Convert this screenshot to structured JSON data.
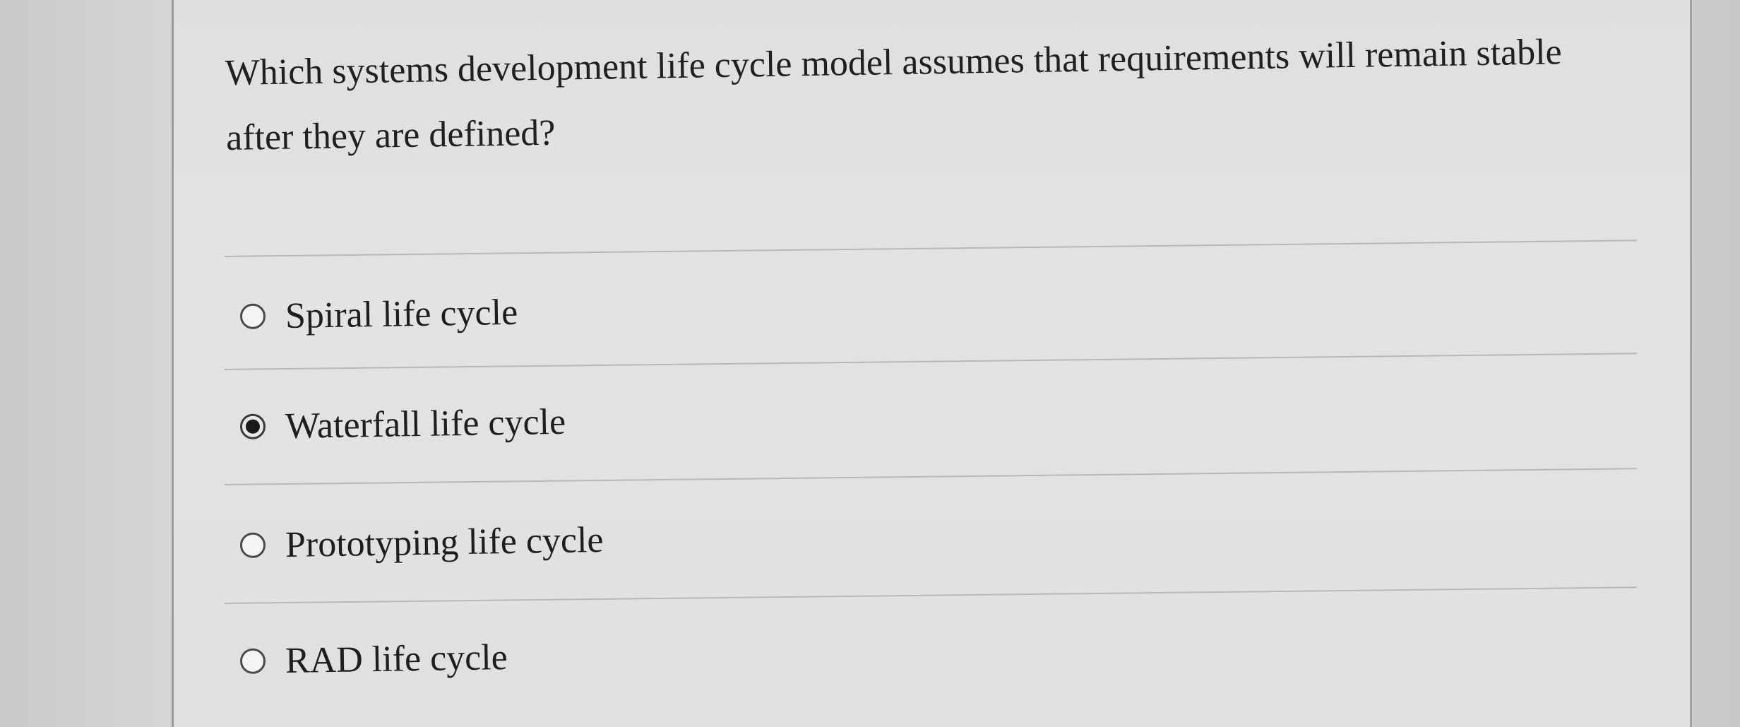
{
  "question": {
    "text": "Which systems development life cycle model assumes that requirements will remain stable after they are defined?"
  },
  "options": [
    {
      "label": "Spiral life cycle",
      "selected": false
    },
    {
      "label": "Waterfall life cycle",
      "selected": true
    },
    {
      "label": "Prototyping life cycle",
      "selected": false
    },
    {
      "label": "RAD life cycle",
      "selected": false
    }
  ],
  "colors": {
    "background": "#d2d2d2",
    "panel": "#e2e2e2",
    "text": "#1e1e1e",
    "divider": "#b8b8b8"
  }
}
